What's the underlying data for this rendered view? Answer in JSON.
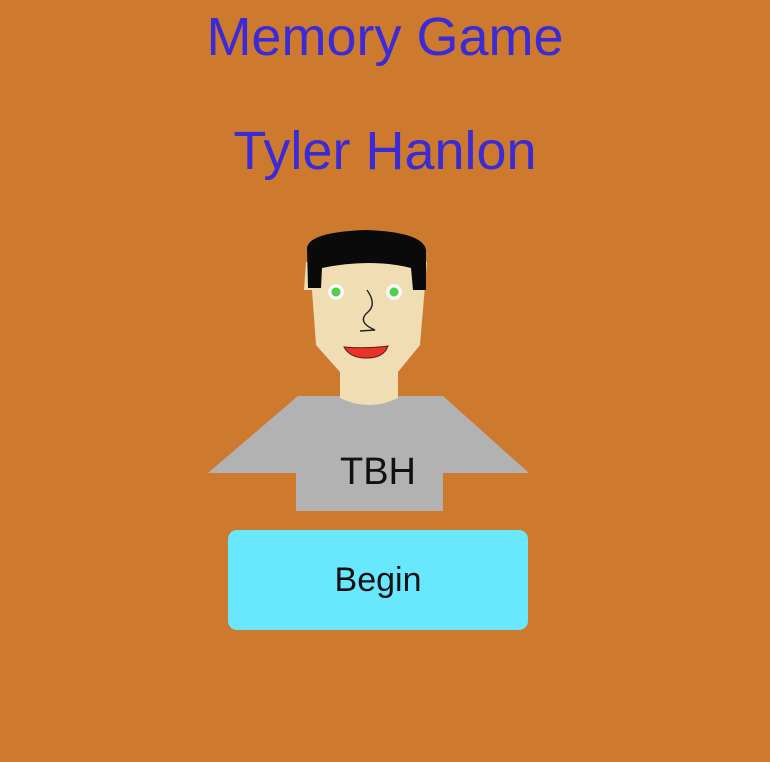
{
  "header": {
    "title": "Memory Game",
    "author": "Tyler Hanlon"
  },
  "avatar": {
    "shirt_text": "TBH"
  },
  "actions": {
    "begin_label": "Begin"
  },
  "colors": {
    "background": "#CD7A2F",
    "title_text": "#3A2BD6",
    "skin": "#F1DDB4",
    "hair": "#0A0A0A",
    "shirt": "#B2B2B2",
    "mouth": "#E8322A",
    "iris": "#4FD04A",
    "button": "#69E8FD"
  },
  "icons": {
    "character": "cartoon-person-avatar"
  }
}
